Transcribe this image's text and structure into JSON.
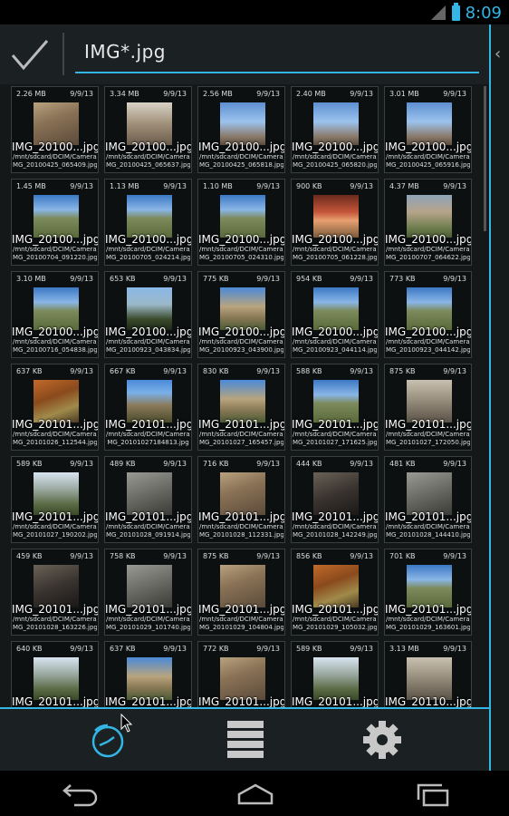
{
  "status": {
    "time": "8:09"
  },
  "search": {
    "query": "IMG*.jpg"
  },
  "files": [
    {
      "size": "2.26 MB",
      "date": "9/9/13",
      "name": "IMG_20100...jpg",
      "path1": "/mnt/sdcard/DCIM/Camera/I",
      "path2": "MG_20100425_065409.jpg",
      "thumb": "rock"
    },
    {
      "size": "3.34 MB",
      "date": "9/9/13",
      "name": "IMG_20100...jpg",
      "path1": "/mnt/sdcard/DCIM/Camera/I",
      "path2": "MG_20100425_065637.jpg",
      "thumb": "rock2"
    },
    {
      "size": "2.56 MB",
      "date": "9/9/13",
      "name": "IMG_20100...jpg",
      "path1": "/mnt/sdcard/DCIM/Camera/I",
      "path2": "MG_20100425_065818.jpg",
      "thumb": "sky"
    },
    {
      "size": "2.40 MB",
      "date": "9/9/13",
      "name": "IMG_20100...jpg",
      "path1": "/mnt/sdcard/DCIM/Camera/I",
      "path2": "MG_20100425_065820.jpg",
      "thumb": "sky"
    },
    {
      "size": "3.01 MB",
      "date": "9/9/13",
      "name": "IMG_20100...jpg",
      "path1": "/mnt/sdcard/DCIM/Camera/I",
      "path2": "MG_20100425_065916.jpg",
      "thumb": "sky"
    },
    {
      "size": "1.45 MB",
      "date": "9/9/13",
      "name": "IMG_20100...jpg",
      "path1": "/mnt/sdcard/DCIM/Camera/I",
      "path2": "MG_20100704_091220.jpg",
      "thumb": "landscape"
    },
    {
      "size": "1.13 MB",
      "date": "9/9/13",
      "name": "IMG_20100...jpg",
      "path1": "/mnt/sdcard/DCIM/Camera/I",
      "path2": "MG_20100705_024214.jpg",
      "thumb": "landscape"
    },
    {
      "size": "1.10 MB",
      "date": "9/9/13",
      "name": "IMG_20100...jpg",
      "path1": "/mnt/sdcard/DCIM/Camera/I",
      "path2": "MG_20100705_024310.jpg",
      "thumb": "landscape"
    },
    {
      "size": "900 KB",
      "date": "9/9/13",
      "name": "IMG_20100...jpg",
      "path1": "/mnt/sdcard/DCIM/Camera/I",
      "path2": "MG_20100705_061228.jpg",
      "thumb": "sunset"
    },
    {
      "size": "4.37 MB",
      "date": "9/9/13",
      "name": "IMG_20100...jpg",
      "path1": "/mnt/sdcard/DCIM/Camera/I",
      "path2": "MG_20100707_064622.jpg",
      "thumb": "canyon"
    },
    {
      "size": "3.10 MB",
      "date": "9/9/13",
      "name": "IMG_20100...jpg",
      "path1": "/mnt/sdcard/DCIM/Camera/I",
      "path2": "MG_20100716_054838.jpg",
      "thumb": "landscape"
    },
    {
      "size": "653 KB",
      "date": "9/9/13",
      "name": "IMG_20100...jpg",
      "path1": "/mnt/sdcard/DCIM/Camera/I",
      "path2": "MG_20100923_043834.jpg",
      "thumb": "tree"
    },
    {
      "size": "775 KB",
      "date": "9/9/13",
      "name": "IMG_20100...jpg",
      "path1": "/mnt/sdcard/DCIM/Camera/I",
      "path2": "MG_20100923_043900.jpg",
      "thumb": "cliff"
    },
    {
      "size": "954 KB",
      "date": "9/9/13",
      "name": "IMG_20100...jpg",
      "path1": "/mnt/sdcard/DCIM/Camera/I",
      "path2": "MG_20100923_044114.jpg",
      "thumb": "landscape"
    },
    {
      "size": "773 KB",
      "date": "9/9/13",
      "name": "IMG_20100...jpg",
      "path1": "/mnt/sdcard/DCIM/Camera/I",
      "path2": "MG_20100923_044142.jpg",
      "thumb": "landscape"
    },
    {
      "size": "637 KB",
      "date": "9/9/13",
      "name": "IMG_20101...jpg",
      "path1": "/mnt/sdcard/DCIM/Camera/I",
      "path2": "MG_20101026_112544.jpg",
      "thumb": "autumn"
    },
    {
      "size": "667 KB",
      "date": "9/9/13",
      "name": "IMG_20101...jpg",
      "path1": "/mnt/sdcard/DCIM/Camera/I",
      "path2": "MG_20101027184813.jpg",
      "thumb": "arch"
    },
    {
      "size": "830 KB",
      "date": "9/9/13",
      "name": "IMG_20101...jpg",
      "path1": "/mnt/sdcard/DCIM/Camera/I",
      "path2": "MG_20101027_165457.jpg",
      "thumb": "cliff"
    },
    {
      "size": "588 KB",
      "date": "9/9/13",
      "name": "IMG_20101...jpg",
      "path1": "/mnt/sdcard/DCIM/Camera/I",
      "path2": "MG_20101027_171625.jpg",
      "thumb": "landscape"
    },
    {
      "size": "875 KB",
      "date": "9/9/13",
      "name": "IMG_20101...jpg",
      "path1": "/mnt/sdcard/DCIM/Camera/I",
      "path2": "MG_20101027_172050.jpg",
      "thumb": "cave"
    },
    {
      "size": "589 KB",
      "date": "9/9/13",
      "name": "IMG_20101...jpg",
      "path1": "/mnt/sdcard/DCIM/Camera/I",
      "path2": "MG_20101027_190202.jpg",
      "thumb": "valley"
    },
    {
      "size": "489 KB",
      "date": "9/9/13",
      "name": "IMG_20101...jpg",
      "path1": "/mnt/sdcard/DCIM/Camera/I",
      "path2": "MG_20101028_091914.jpg",
      "thumb": "gray"
    },
    {
      "size": "716 KB",
      "date": "9/9/13",
      "name": "IMG_20101...jpg",
      "path1": "/mnt/sdcard/DCIM/Camera/I",
      "path2": "MG_20101028_112331.jpg",
      "thumb": "rock"
    },
    {
      "size": "444 KB",
      "date": "9/9/13",
      "name": "IMG_20101...jpg",
      "path1": "/mnt/sdcard/DCIM/Camera/I",
      "path2": "MG_20101028_142249.jpg",
      "thumb": "dark"
    },
    {
      "size": "481 KB",
      "date": "9/9/13",
      "name": "IMG_20101...jpg",
      "path1": "/mnt/sdcard/DCIM/Camera/I",
      "path2": "MG_20101028_144410.jpg",
      "thumb": "gray"
    },
    {
      "size": "459 KB",
      "date": "9/9/13",
      "name": "IMG_20101...jpg",
      "path1": "/mnt/sdcard/DCIM/Camera/I",
      "path2": "MG_20101028_163226.jpg",
      "thumb": "dark"
    },
    {
      "size": "758 KB",
      "date": "9/9/13",
      "name": "IMG_20101...jpg",
      "path1": "/mnt/sdcard/DCIM/Camera/I",
      "path2": "MG_20101029_101740.jpg",
      "thumb": "gray"
    },
    {
      "size": "875 KB",
      "date": "9/9/13",
      "name": "IMG_20101...jpg",
      "path1": "/mnt/sdcard/DCIM/Camera/I",
      "path2": "MG_20101029_104804.jpg",
      "thumb": "rock"
    },
    {
      "size": "856 KB",
      "date": "9/9/13",
      "name": "IMG_20101...jpg",
      "path1": "/mnt/sdcard/DCIM/Camera/I",
      "path2": "MG_20101029_105032.jpg",
      "thumb": "autumn"
    },
    {
      "size": "701 KB",
      "date": "9/9/13",
      "name": "IMG_20101...jpg",
      "path1": "/mnt/sdcard/DCIM/Camera/I",
      "path2": "MG_20101029_163601.jpg",
      "thumb": "landscape"
    },
    {
      "size": "640 KB",
      "date": "9/9/13",
      "name": "IMG_20101...jpg",
      "path1": "",
      "path2": "",
      "thumb": "valley"
    },
    {
      "size": "637 KB",
      "date": "9/9/13",
      "name": "IMG_20101...jpg",
      "path1": "",
      "path2": "",
      "thumb": "cliff"
    },
    {
      "size": "772 KB",
      "date": "9/9/13",
      "name": "IMG_20101...jpg",
      "path1": "",
      "path2": "",
      "thumb": "rock"
    },
    {
      "size": "589 KB",
      "date": "9/9/13",
      "name": "IMG_20101...jpg",
      "path1": "",
      "path2": "",
      "thumb": "valley"
    },
    {
      "size": "3.13 MB",
      "date": "9/9/13",
      "name": "IMG_20110...jpg",
      "path1": "",
      "path2": "",
      "thumb": "cave"
    }
  ],
  "icons": {
    "confirm": "checkmark-icon",
    "collapse": "chevron-left-icon",
    "history": "history-clock-icon",
    "list": "list-view-icon",
    "settings": "gear-icon",
    "back": "back-icon",
    "home": "home-icon",
    "recents": "recent-apps-icon"
  },
  "colors": {
    "accent": "#33b5e5"
  }
}
